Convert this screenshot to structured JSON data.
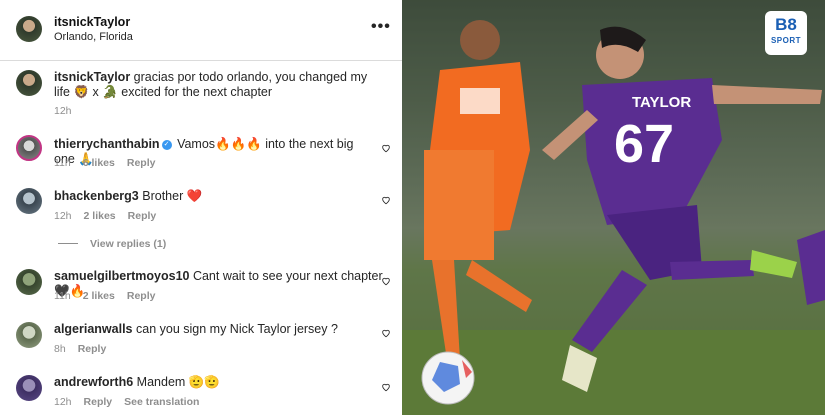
{
  "post": {
    "author": "itsnickTaylor",
    "location": "Orlando, Florida",
    "caption": "gracias por todo orlando, you changed my life 🦁 x 🐊 excited for the next chapter",
    "time": "12h"
  },
  "comments": [
    {
      "user": "thierrychanthabin",
      "verified": true,
      "text": "Vamos🔥🔥🔥 into the next big one 🙏",
      "time": "11h",
      "likes": "6 likes",
      "reply": "Reply"
    },
    {
      "user": "bhackenberg3",
      "text": "Brother ❤️",
      "time": "12h",
      "likes": "2 likes",
      "reply": "Reply",
      "view_replies": "View replies (1)"
    },
    {
      "user": "samuelgilbertmoyos10",
      "text": "Cant wait to see your next chapter🖤🔥",
      "time": "11h",
      "likes": "2 likes",
      "reply": "Reply"
    },
    {
      "user": "algerianwalls",
      "text": "can you sign my Nick Taylor jersey ?",
      "time": "8h",
      "reply": "Reply"
    },
    {
      "user": "andrewforth6",
      "text": "Mandem 🫡🫡",
      "time": "12h",
      "reply": "Reply",
      "see_translation": "See translation"
    }
  ],
  "photo": {
    "jersey_name": "TAYLOR",
    "jersey_number": "67",
    "logo_top": "B8",
    "logo_bottom": "SPORT"
  },
  "colors": {
    "verified": "#3897f0",
    "orlando_purple": "#5a2d91",
    "cincinnati_orange": "#f26b21"
  }
}
